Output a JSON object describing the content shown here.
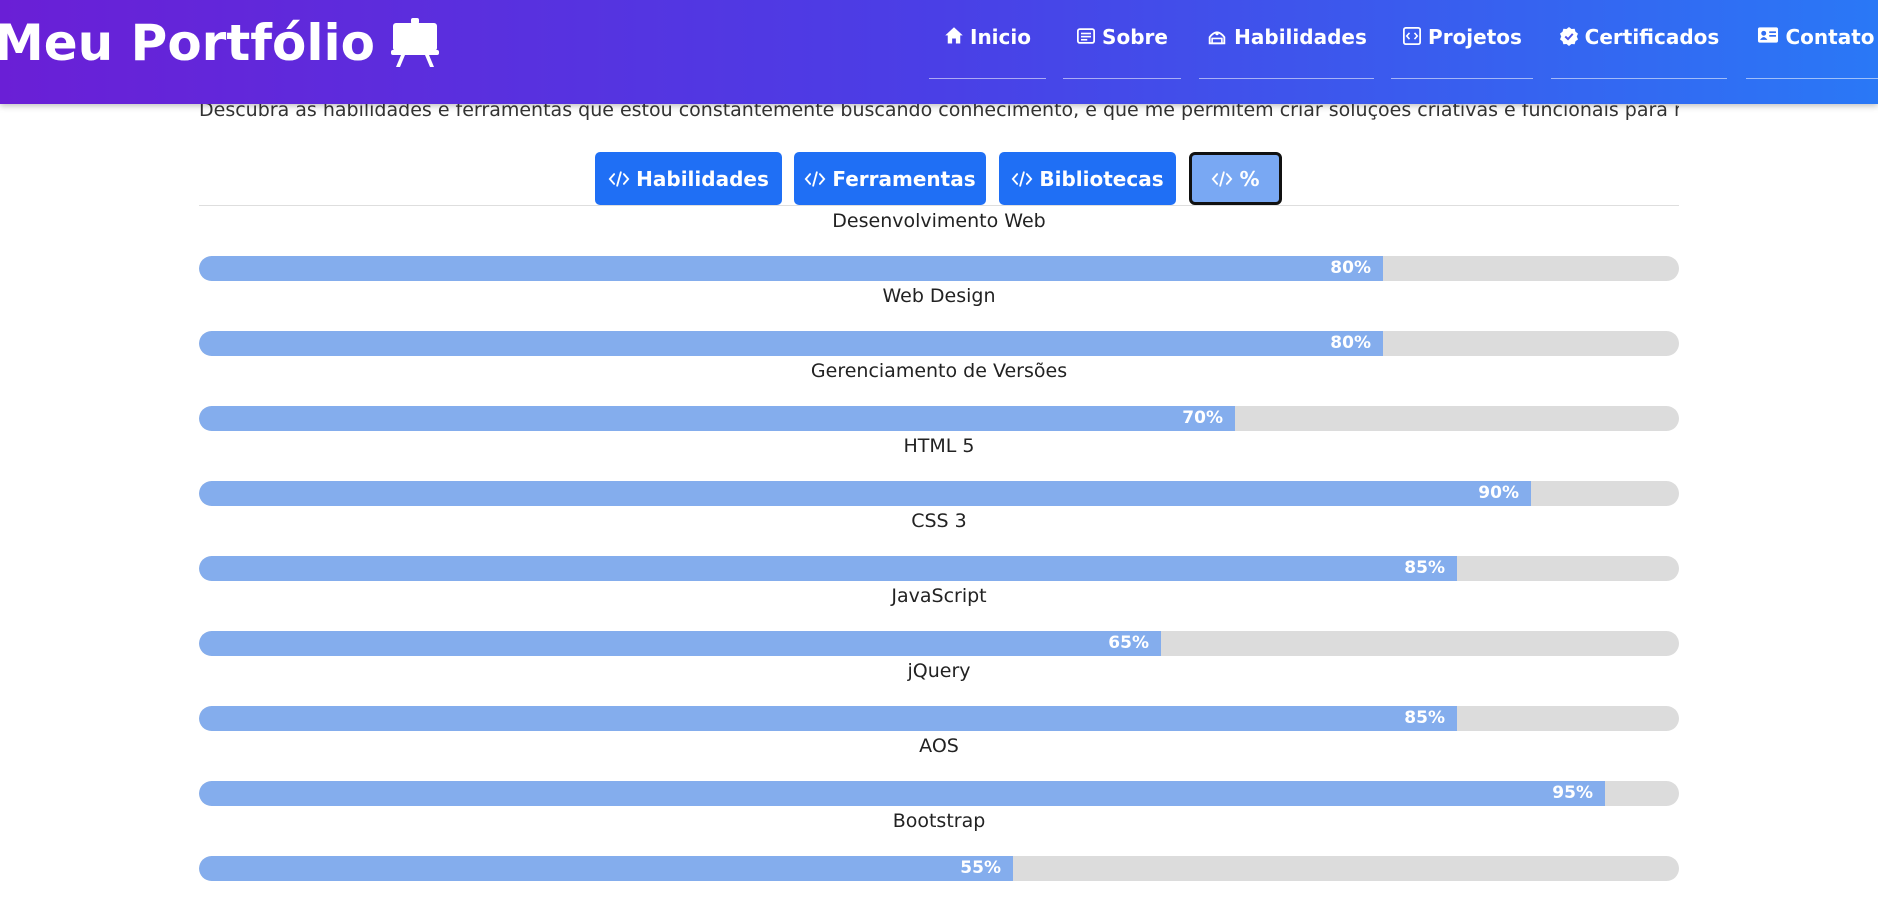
{
  "header": {
    "brand": "Meu Portfólio",
    "brand_icon": "easel-icon",
    "nav": [
      {
        "label": "Inicio",
        "icon": "home-icon"
      },
      {
        "label": "Sobre",
        "icon": "article-icon"
      },
      {
        "label": "Habilidades",
        "icon": "tools-icon"
      },
      {
        "label": "Projetos",
        "icon": "code-square-icon"
      },
      {
        "label": "Certificados",
        "icon": "patch-check-icon"
      },
      {
        "label": "Contato",
        "icon": "contact-card-icon"
      }
    ]
  },
  "intro": "Descubra as habilidades e ferramentas que estou constantemente buscando conhecimento, e que me permitem criar soluções criativas e funcionais para meus projetos.",
  "tabs": [
    {
      "label": "Habilidades",
      "icon": "code-slash-icon",
      "active": false
    },
    {
      "label": "Ferramentas",
      "icon": "code-slash-icon",
      "active": false
    },
    {
      "label": "Bibliotecas",
      "icon": "code-slash-icon",
      "active": false
    },
    {
      "label": "%",
      "icon": "code-slash-icon",
      "active": true
    }
  ],
  "skills": [
    {
      "name": "Desenvolvimento Web",
      "percent": 80,
      "percent_label": "80%"
    },
    {
      "name": "Web Design",
      "percent": 80,
      "percent_label": "80%"
    },
    {
      "name": "Gerenciamento de Versões",
      "percent": 70,
      "percent_label": "70%"
    },
    {
      "name": "HTML 5",
      "percent": 90,
      "percent_label": "90%"
    },
    {
      "name": "CSS 3",
      "percent": 85,
      "percent_label": "85%"
    },
    {
      "name": "JavaScript",
      "percent": 65,
      "percent_label": "65%"
    },
    {
      "name": "jQuery",
      "percent": 85,
      "percent_label": "85%"
    },
    {
      "name": "AOS",
      "percent": 95,
      "percent_label": "95%"
    },
    {
      "name": "Bootstrap",
      "percent": 55,
      "percent_label": "55%"
    }
  ],
  "colors": {
    "nav_gradient_start": "#6a1fd6",
    "nav_gradient_end": "#2a78f6",
    "tab_button": "#1f6ff5",
    "tab_active": "#79a8f3",
    "bar_fill": "#84aded",
    "bar_track": "#dcdcdc"
  }
}
